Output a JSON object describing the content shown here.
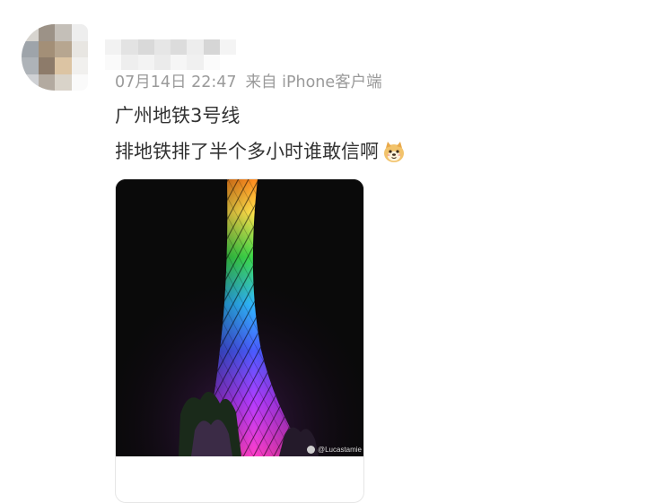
{
  "post": {
    "avatar_blurred": true,
    "username_blurred": true,
    "timestamp": "07月14日 22:47",
    "source": "来自 iPhone客户端",
    "text_line1": "广州地铁3号线",
    "text_line2": "排地铁排了半个多小时谁敢信啊",
    "emoji": "doge-emoji",
    "image": {
      "subject": "rainbow-lit-tower",
      "watermark": "@Lucastamie"
    }
  }
}
